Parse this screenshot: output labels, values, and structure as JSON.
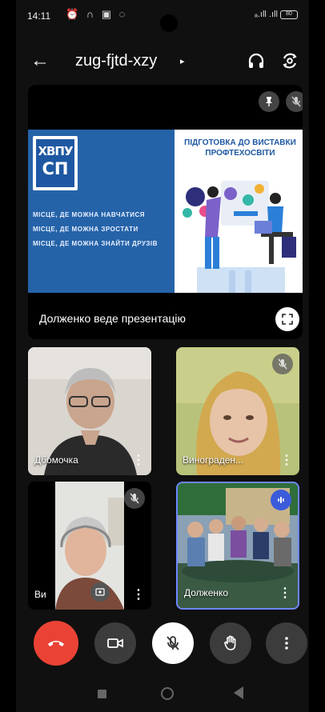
{
  "status_bar": {
    "time": "14:11",
    "left_icons": "⏰ ∩ ▣ ◌",
    "signal": "ₐ.ıll .ıll",
    "battery": "80"
  },
  "top_bar": {
    "back_icon": "arrow-left-icon",
    "meeting_code": "zug-fjtd-xzy",
    "caret": "▸"
  },
  "presentation": {
    "logo_line1": "ХВПУ",
    "logo_line2": "СП",
    "slide_lines": [
      "МІСЦЕ, ДЕ МОЖНА НАВЧАТИСЯ",
      "МІСЦЕ, ДЕ МОЖНА ЗРОСТАТИ",
      "МІСЦЕ, ДЕ МОЖНА ЗНАЙТИ ДРУЗІВ"
    ],
    "slide_title": "ПІДГОТОВКА ДО ВИСТАВКИ ПРОФТЕХОСВІТИ",
    "presenter_label": "Долженко веде презентацію"
  },
  "participants": [
    {
      "name": "Дбомочка",
      "muted": false
    },
    {
      "name": "Винограден...",
      "muted": true
    },
    {
      "name": "Ви",
      "muted": true
    },
    {
      "name": "Долженко",
      "muted": false,
      "speaking": true
    }
  ],
  "more_glyph": "⋮",
  "colors": {
    "end_call": "#ea4335",
    "active_speaker": "#6e86ff",
    "slide_blue": "#2563a8"
  }
}
